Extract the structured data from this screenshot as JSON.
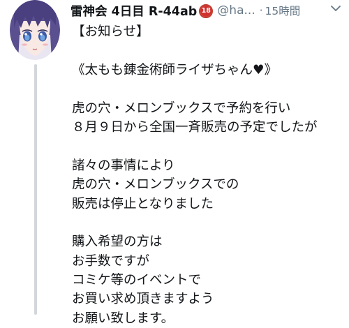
{
  "tweet": {
    "display_name": "雷神会 4日目 R-44ab",
    "badge_text": "18",
    "handle": "@ha...",
    "dot": "·",
    "time": "15時間",
    "avatar_icon": "anime-avatar",
    "caret_icon": "chevron-down-icon",
    "text_lines": [
      "【お知らせ】",
      "",
      "《太もも錬金術師ライザちゃん♥》",
      "",
      "虎の穴・メロンブックスで予約を行い",
      "８月９日から全国一斉販売の予定でしたが",
      "",
      "諸々の事情により",
      "虎の穴・メロンブックスでの",
      "販売は停止となりました",
      "",
      "購入希望の方は",
      "お手数ですが",
      "コミケ等のイベントで",
      "お買い求め頂きますよう",
      "お願い致します。"
    ]
  },
  "colors": {
    "text": "#14171a",
    "muted": "#657786",
    "thread_line": "#d3d7db",
    "badge": "#d0312d"
  }
}
